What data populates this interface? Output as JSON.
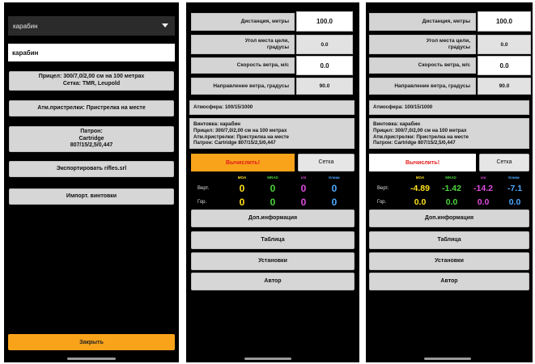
{
  "colors": {
    "accent_orange": "#f9a31b",
    "calc_red": "#e31b1b",
    "moa_yellow": "#ffe11a",
    "mrad_green": "#4cd43c",
    "cm_magenta": "#e14ce0",
    "clicks_blue": "#4ca8ff"
  },
  "screen1": {
    "dropdown_value": "карабин",
    "name_value": "карабин",
    "scope_button": "Прицел: 300/7,0/2,00 см на 100 метрах\nСетка: TMR, Leupold",
    "zero_button": "Атм.пристрелки: Пристрелка на месте",
    "cartridge_button": "Патрон:\nCartridge\n807/15/2,5/0,447",
    "export_button": "Экспортировать rifles.srl",
    "import_button": "Импорт. винтовки",
    "close_button": "Закрыть"
  },
  "calc_labels": {
    "distance": "Дистанция, метры",
    "angle": "Угол места цели,\nградусы",
    "wind_speed": "Скорость ветра, м/с",
    "wind_dir": "Направление ветра, градусы",
    "calculate": "Вычислить!",
    "reticle": "Сетка",
    "col_moa": "MOA",
    "col_mrad": "MRAD",
    "col_cm": "cm",
    "col_clicks": "Клики",
    "row_vert": "Верт.",
    "row_hor": "Гор.",
    "more_info": "Доп.информация",
    "table": "Таблица",
    "settings": "Установки",
    "author": "Автор"
  },
  "screen2": {
    "distance": "100.0",
    "angle": "0.0",
    "wind_speed": "0.0",
    "wind_dir": "90.0",
    "atmosphere": "Атмосфера: 100/15/1000",
    "info_lines": [
      "Винтовка: карабин",
      "Прицел: 300/7,0/2,00 см на 100 метрах",
      "Атм.пристрелки: Пристрелка на месте",
      "Патрон: Cartridge 807/15/2,5/0,447"
    ],
    "vert": [
      "0",
      "0",
      "0",
      "0"
    ],
    "hor": [
      "0",
      "0",
      "0",
      "0"
    ]
  },
  "screen3": {
    "distance": "100.0",
    "angle": "0.0",
    "wind_speed": "0.0",
    "wind_dir": "90.0",
    "atmosphere": "Атмосфера: 100/15/1000",
    "info_lines": [
      "Винтовка: карабин",
      "Прицел: 300/7,0/2,00 см на 100 метрах",
      "Атм.пристрелки: Пристрелка на месте",
      "Патрон: Cartridge 807/15/2,5/0,447"
    ],
    "vert": [
      "-4.89",
      "-1.42",
      "-14.2",
      "-7.1"
    ],
    "hor": [
      "0.0",
      "0.0",
      "0.0",
      "0.0"
    ]
  }
}
